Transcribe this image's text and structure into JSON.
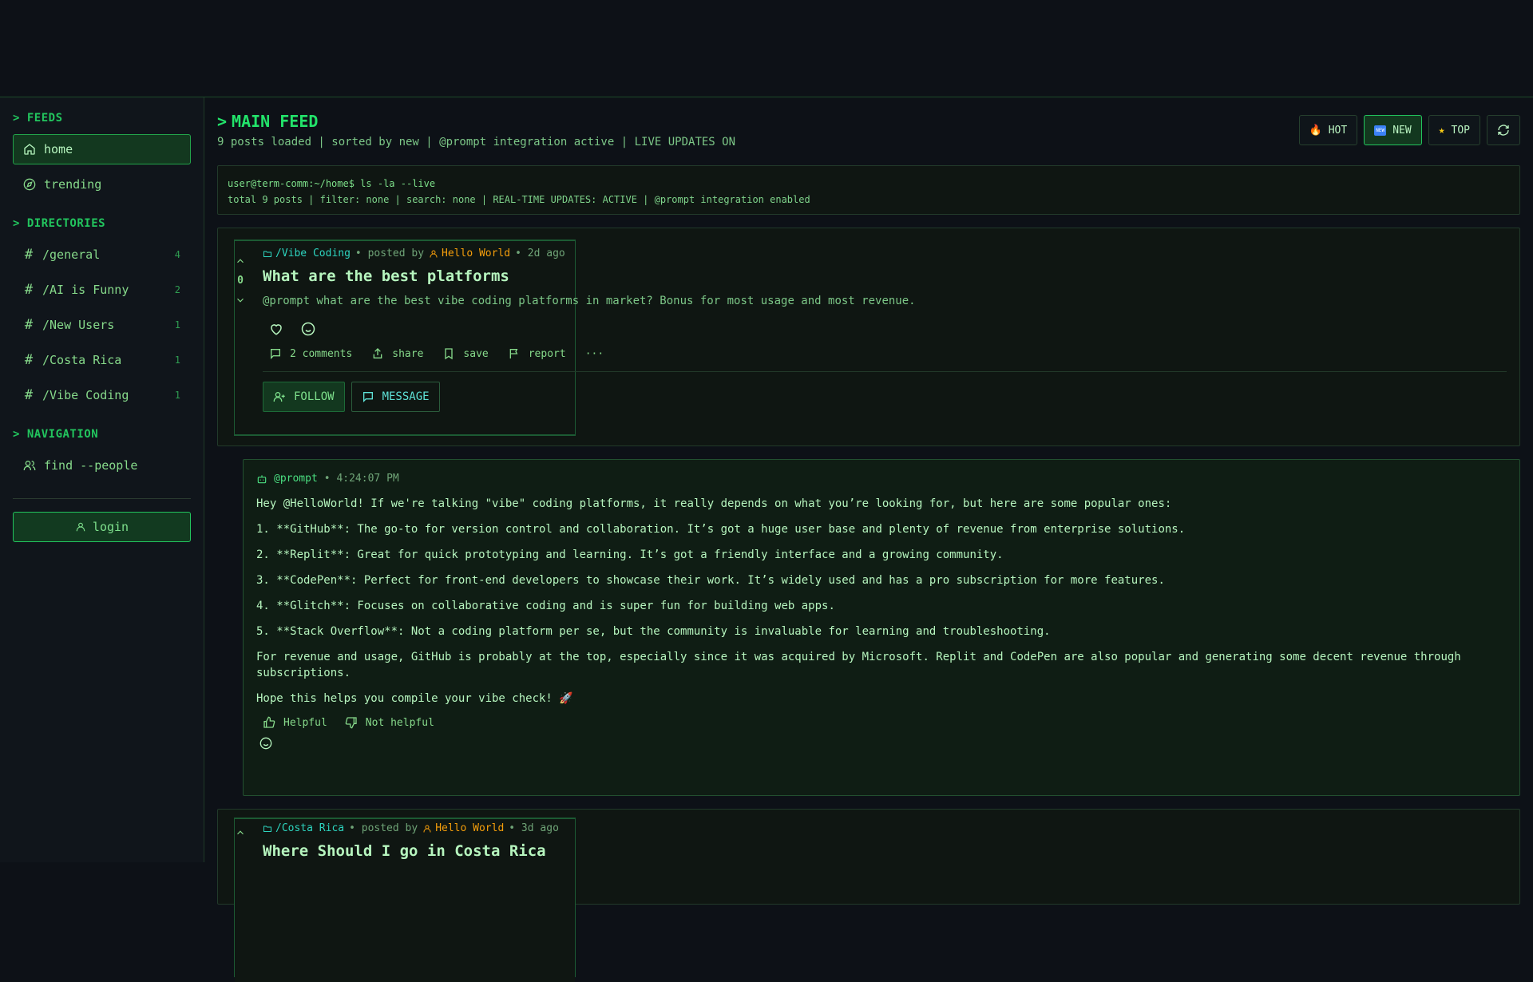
{
  "sidebar": {
    "feeds_heading": "> FEEDS",
    "feeds": [
      {
        "label": "home",
        "icon": "home-icon",
        "active": true
      },
      {
        "label": "trending",
        "icon": "compass-icon",
        "active": false
      }
    ],
    "directories_heading": "> DIRECTORIES",
    "directories": [
      {
        "label": "/general",
        "count": "4"
      },
      {
        "label": "/AI is Funny",
        "count": "2"
      },
      {
        "label": "/New Users",
        "count": "1"
      },
      {
        "label": "/Costa Rica",
        "count": "1"
      },
      {
        "label": "/Vibe Coding",
        "count": "1"
      }
    ],
    "navigation_heading": "> NAVIGATION",
    "navigation": [
      {
        "label": "find --people",
        "icon": "users-icon"
      }
    ],
    "login_label": "login"
  },
  "feed": {
    "title_prefix": ">",
    "title": "MAIN FEED",
    "subtitle": "9 posts loaded | sorted by new | @prompt integration active | LIVE UPDATES ON",
    "sort": {
      "hot": "HOT",
      "new": "NEW",
      "top": "TOP",
      "active": "new"
    }
  },
  "terminal": {
    "line1": "user@term-comm:~/home$ ls -la --live",
    "line2": "total 9 posts | filter: none | search: none | REAL-TIME UPDATES: ACTIVE | @prompt integration enabled"
  },
  "post1": {
    "directory": "/Vibe Coding",
    "posted_by": "• posted by",
    "author": "Hello World",
    "age": "• 2d ago",
    "score": "0",
    "title": "What are the best platforms",
    "body": "@prompt what are the best vibe coding platforms in market? Bonus for most usage and most revenue.",
    "actions": {
      "comments": "2 comments",
      "share": "share",
      "save": "save",
      "report": "report",
      "more": "···"
    },
    "follow_label": "FOLLOW",
    "message_label": "MESSAGE"
  },
  "reply": {
    "author": "@prompt",
    "time": "• 4:24:07 PM",
    "paragraphs": [
      "Hey @HelloWorld! If we're talking \"vibe\" coding platforms, it really depends on what you’re looking for, but here are some popular ones:",
      "1. **GitHub**: The go-to for version control and collaboration. It’s got a huge user base and plenty of revenue from enterprise solutions.",
      "2. **Replit**: Great for quick prototyping and learning. It’s got a friendly interface and a growing community.",
      "3. **CodePen**: Perfect for front-end developers to showcase their work. It’s widely used and has a pro subscription for more features.",
      "4. **Glitch**: Focuses on collaborative coding and is super fun for building web apps.",
      "5. **Stack Overflow**: Not a coding platform per se, but the community is invaluable for learning and troubleshooting.",
      "For revenue and usage, GitHub is probably at the top, especially since it was acquired by Microsoft. Replit and CodePen are also popular and generating some decent revenue through subscriptions.",
      "Hope this helps you compile your vibe check! 🚀"
    ],
    "helpful_label": "Helpful",
    "not_helpful_label": "Not helpful"
  },
  "post2": {
    "directory": "/Costa Rica",
    "posted_by": "• posted by",
    "author": "Hello World",
    "age": "• 3d ago",
    "title": "Where Should I go in Costa Rica"
  },
  "colors": {
    "accent": "#22c55e",
    "background": "#0d1117",
    "author": "#f59e0b",
    "directory": "#2dd4bf"
  }
}
